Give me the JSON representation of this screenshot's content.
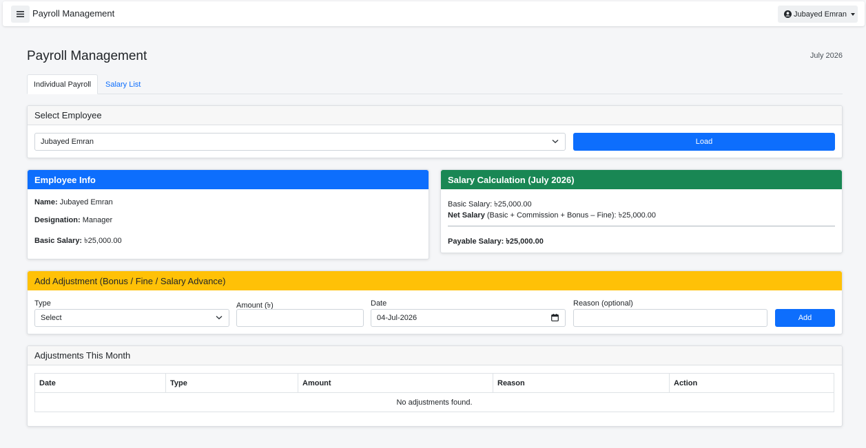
{
  "navbar": {
    "title": "Payroll Management",
    "user_name": "Jubayed Emran"
  },
  "page": {
    "title": "Payroll Management",
    "month": "July 2026"
  },
  "tabs": [
    {
      "label": "Individual Payroll",
      "active": true
    },
    {
      "label": "Salary List",
      "active": false
    }
  ],
  "select_employee": {
    "header": "Select Employee",
    "selected": "Jubayed Emran",
    "load_label": "Load"
  },
  "employee_info": {
    "header": "Employee Info",
    "name_label": "Name:",
    "name_value": "Jubayed Emran",
    "designation_label": "Designation:",
    "designation_value": "Manager",
    "basic_label": "Basic Salary:",
    "basic_value": "৳25,000.00"
  },
  "salary_calc": {
    "header": "Salary Calculation (July 2026)",
    "basic_line": "Basic Salary: ৳25,000.00",
    "net_label": "Net Salary",
    "net_formula": "(Basic + Commission + Bonus – Fine): ৳25,000.00",
    "payable_label": "Payable Salary:",
    "payable_value": "৳25,000.00"
  },
  "adjustment": {
    "header": "Add Adjustment (Bonus / Fine / Salary Advance)",
    "type_label": "Type",
    "type_value": "Select",
    "amount_label": "Amount (৳)",
    "amount_value": "",
    "date_label": "Date",
    "date_value": "04-Jul-2026",
    "reason_label": "Reason (optional)",
    "reason_value": "",
    "add_label": "Add"
  },
  "adjustments_table": {
    "header": "Adjustments This Month",
    "columns": [
      "Date",
      "Type",
      "Amount",
      "Reason",
      "Action"
    ],
    "empty_message": "No adjustments found."
  },
  "colors": {
    "primary": "#0d6efd",
    "success": "#198754",
    "warning": "#ffc107"
  }
}
